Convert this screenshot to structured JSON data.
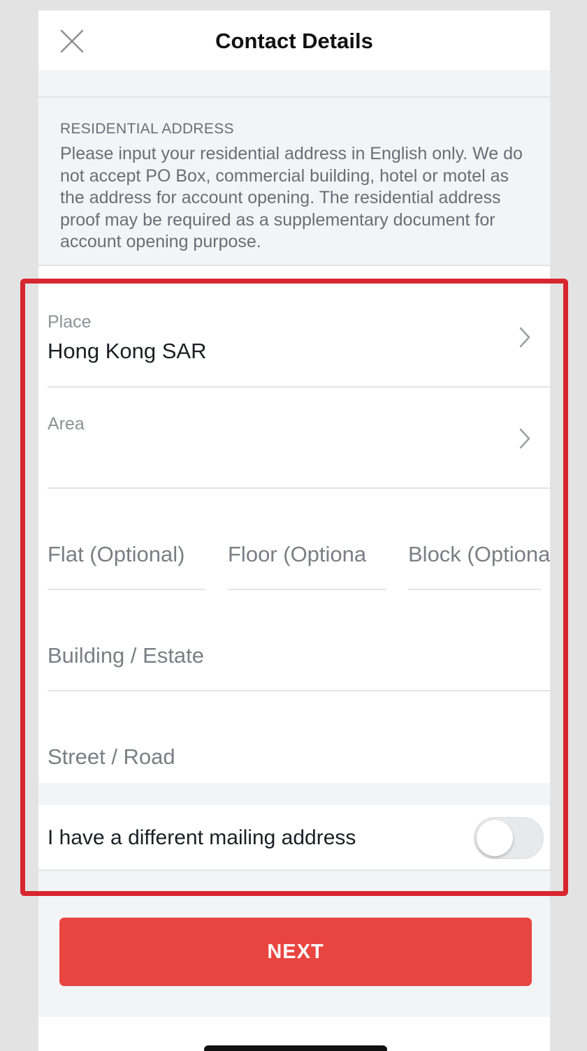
{
  "header": {
    "title": "Contact Details",
    "close_icon": "close-icon"
  },
  "residential_info": {
    "heading": "RESIDENTIAL ADDRESS",
    "description": "Please input your residential address in English only. We do not accept PO Box, commercial building, hotel or motel as the address for account opening. The residential address proof may be required as a supplementary document for account opening purpose."
  },
  "form": {
    "place": {
      "label": "Place",
      "value": "Hong Kong SAR",
      "icon": "chevron-right-icon"
    },
    "area": {
      "label": "Area",
      "value": "",
      "icon": "chevron-right-icon"
    },
    "flat": {
      "placeholder": "Flat (Optional)"
    },
    "floor": {
      "placeholder": "Floor (Optiona"
    },
    "block": {
      "placeholder": "Block (Optiona"
    },
    "building": {
      "placeholder": "Building / Estate"
    },
    "street": {
      "placeholder": "Street / Road"
    }
  },
  "mailing": {
    "label": "I have a different mailing address",
    "enabled": false
  },
  "next_button": {
    "label": "NEXT"
  },
  "colors": {
    "accent": "#e94540",
    "highlight": "#d8262f",
    "background": "#f3f4f6"
  }
}
